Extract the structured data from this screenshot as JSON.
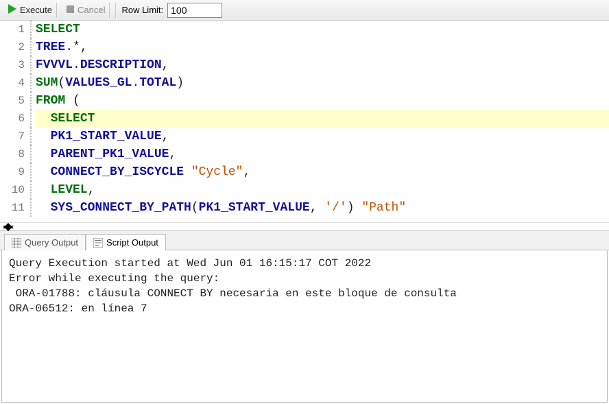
{
  "toolbar": {
    "execute_label": "Execute",
    "cancel_label": "Cancel",
    "rowlimit_label": "Row Limit:",
    "rowlimit_value": "100"
  },
  "editor": {
    "highlighted_line": 6,
    "lines": [
      {
        "n": 1,
        "tokens": [
          [
            "kw",
            "SELECT"
          ]
        ]
      },
      {
        "n": 2,
        "tokens": [
          [
            "id",
            "TREE"
          ],
          [
            "punct",
            ".*,"
          ]
        ]
      },
      {
        "n": 3,
        "tokens": [
          [
            "id",
            "FVVVL"
          ],
          [
            "punct",
            "."
          ],
          [
            "id",
            "DESCRIPTION"
          ],
          [
            "punct",
            ","
          ]
        ]
      },
      {
        "n": 4,
        "tokens": [
          [
            "kw",
            "SUM"
          ],
          [
            "punct",
            "("
          ],
          [
            "id",
            "VALUES_GL"
          ],
          [
            "punct",
            "."
          ],
          [
            "id",
            "TOTAL"
          ],
          [
            "punct",
            ")"
          ]
        ]
      },
      {
        "n": 5,
        "tokens": [
          [
            "kw",
            "FROM"
          ],
          [
            "punct",
            " ("
          ]
        ]
      },
      {
        "n": 6,
        "tokens": [
          [
            "punct",
            "  "
          ],
          [
            "kw",
            "SELECT"
          ]
        ]
      },
      {
        "n": 7,
        "tokens": [
          [
            "punct",
            "  "
          ],
          [
            "id",
            "PK1_START_VALUE"
          ],
          [
            "punct",
            ","
          ]
        ]
      },
      {
        "n": 8,
        "tokens": [
          [
            "punct",
            "  "
          ],
          [
            "id",
            "PARENT_PK1_VALUE"
          ],
          [
            "punct",
            ","
          ]
        ]
      },
      {
        "n": 9,
        "tokens": [
          [
            "punct",
            "  "
          ],
          [
            "id",
            "CONNECT_BY_ISCYCLE"
          ],
          [
            "punct",
            " "
          ],
          [
            "str",
            "\"Cycle\""
          ],
          [
            "punct",
            ","
          ]
        ]
      },
      {
        "n": 10,
        "tokens": [
          [
            "punct",
            "  "
          ],
          [
            "kw",
            "LEVEL"
          ],
          [
            "punct",
            ","
          ]
        ]
      },
      {
        "n": 11,
        "tokens": [
          [
            "punct",
            "  "
          ],
          [
            "id",
            "SYS_CONNECT_BY_PATH"
          ],
          [
            "punct",
            "("
          ],
          [
            "id",
            "PK1_START_VALUE"
          ],
          [
            "punct",
            ", "
          ],
          [
            "str",
            "'/'"
          ],
          [
            "punct",
            ") "
          ],
          [
            "str",
            "\"Path\""
          ]
        ]
      }
    ]
  },
  "tabs": {
    "query_output": "Query Output",
    "script_output": "Script Output",
    "active": "script_output"
  },
  "output": {
    "lines": [
      "Query Execution started at Wed Jun 01 16:15:17 COT 2022",
      "Error while executing the query:",
      " ORA-01788: cláusula CONNECT BY necesaria en este bloque de consulta",
      "ORA-06512: en línea 7"
    ]
  }
}
